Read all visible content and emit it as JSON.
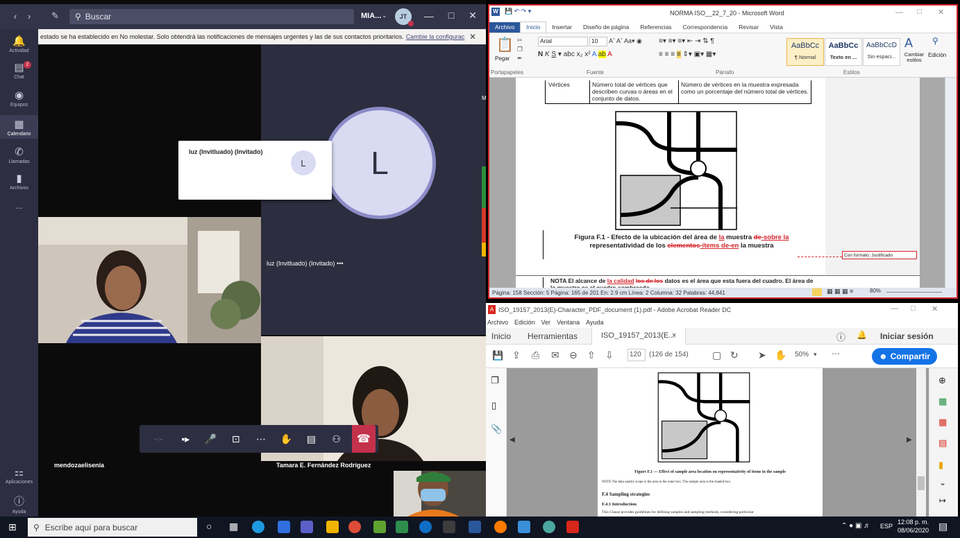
{
  "teams": {
    "search_placeholder": "Buscar",
    "user_label": "MIA...",
    "user_initials": "JT",
    "rail": [
      {
        "label": "Actividad",
        "icon": "bell-icon"
      },
      {
        "label": "Chat",
        "icon": "chat-icon",
        "badge": "2"
      },
      {
        "label": "Equipos",
        "icon": "teams-icon"
      },
      {
        "label": "Calendario",
        "icon": "calendar-icon"
      },
      {
        "label": "Llamadas",
        "icon": "phone-icon"
      },
      {
        "label": "Archivos",
        "icon": "files-icon"
      },
      {
        "label": "...",
        "icon": "more-icon"
      },
      {
        "label": "Aplicaciones",
        "icon": "apps-icon"
      },
      {
        "label": "Ayuda",
        "icon": "help-icon"
      }
    ],
    "banner_text": "estado se ha establecido en No molestar. Solo obtendrá las notificaciones de mensajes urgentes y las de sus contactos prioritarios.",
    "banner_link": "Cambie la configurac",
    "card_title": "luz (Invitluado) (Invitado)",
    "card_initial": "L",
    "big_initial": "L",
    "luz_label": "luz (Invitluado) (Invitado) •••",
    "participant_1": "mendozaelisenia",
    "participant_2": "Tamara E. Fernández Rodríguez",
    "call_timer": "--:--",
    "side_fragment": "Me"
  },
  "word": {
    "title": "NORMA ISO__22_7_20 - Microsoft Word",
    "tabs": [
      "Archivo",
      "Inicio",
      "Insertar",
      "Diseño de página",
      "Referencias",
      "Correspondencia",
      "Revisar",
      "Vista"
    ],
    "font_name": "Arial",
    "font_size": "10",
    "paste_label": "Pegar",
    "groups": [
      "Portapapeles",
      "Fuente",
      "Párrafo",
      "Estilos"
    ],
    "styles": [
      {
        "sample": "AaBbCc",
        "name": "¶ Normal"
      },
      {
        "sample": "AaBbCc",
        "name": "Texto en ..."
      },
      {
        "sample": "AaBbCcD",
        "name": "Sin espaci..."
      }
    ],
    "change_styles": "Cambiar estilos",
    "edit_label": "Edición",
    "table": {
      "col1": "Vértices",
      "col2": "Número total de vértices que describen curvas o áreas en el conjunto de datos.",
      "col3": "Número de vértices en la muestra expresada como un porcentaje del número total de vértices."
    },
    "caption_a": "Figura F.1",
    "caption_b": " - Efecto de la ubicación del área de ",
    "caption_ins1": "la",
    "caption_c": " muestra ",
    "caption_del1": "de",
    "caption_ins2": "-sobre la",
    "caption_d": "representatividad de los ",
    "caption_del2": "elementos",
    "caption_ins3": "-ítems de-en",
    "caption_e": " la muestra",
    "comment": "Con formato: Justificado",
    "note_a": "NOTA  El alcance de ",
    "note_ins": "la calidad",
    "note_del": "los de los",
    "note_b": " datos es el área que esta fuera del cuadro. El área de la muestra es el cuadro sombreado.",
    "status": "Página: 158   Sección: 5   Página: 165 de 201   En: 2.9 cm   Línea: 2   Columna: 32   Palabras: 44,841",
    "zoom": "80%"
  },
  "acrobat": {
    "title": "ISO_19157_2013(E)-Character_PDF_document (1).pdf - Adobe Acrobat Reader DC",
    "menu": [
      "Archivo",
      "Edición",
      "Ver",
      "Ventana",
      "Ayuda"
    ],
    "tab_home": "Inicio",
    "tab_tools": "Herramientas",
    "tab_doc": "ISO_19157_2013(E...",
    "signin": "Iniciar sesión",
    "page_number": "120",
    "page_of": "(126 de 154)",
    "zoom": "50%",
    "share": "Compartir",
    "caption": "Figure F.1 — Effect of sample area location on representativity of items in the sample",
    "note": "NOTE      The data quality scope is the area in the outer box. The sample area is the shaded box.",
    "h1": "F.4    Sampling strategies",
    "h2": "F.4.1    Introduction",
    "body": "This Clause provides guidelines for defining samples and sampling methods, considering particular"
  },
  "taskbar": {
    "search_placeholder": "Escribe aquí para buscar",
    "time": "12:08 p. m.",
    "date": "08/06/2020",
    "lang": "ESP"
  }
}
